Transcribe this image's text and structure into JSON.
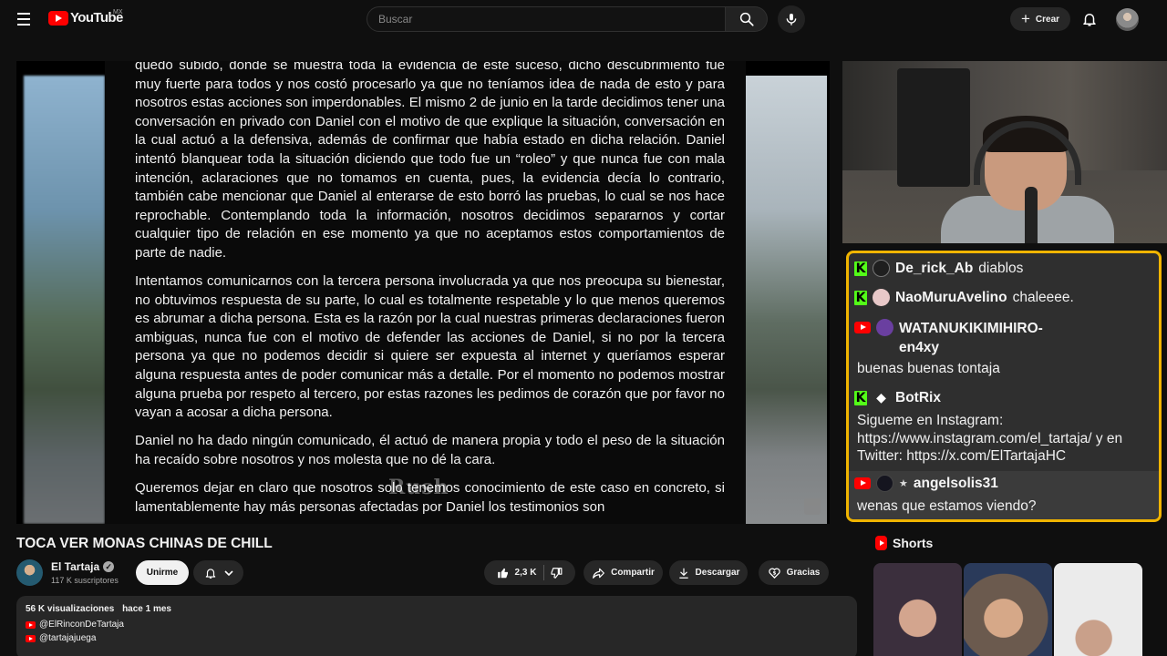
{
  "header": {
    "logo_text": "YouTube",
    "country": "MX",
    "search_placeholder": "Buscar",
    "create_label": "Crear"
  },
  "video": {
    "document_paragraphs": [
      "quedó subido, donde se muestra toda la evidencia de este suceso, dicho descubrimiento fue muy fuerte para todos y nos costó procesarlo ya que no teníamos idea de nada de esto y para nosotros estas acciones son imperdonables. El mismo 2 de junio en la tarde decidimos tener una conversación en privado con Daniel con el motivo de que explique la situación, conversación en la cual actuó a la defensiva, además de confirmar que había estado en dicha relación. Daniel intentó blanquear toda la situación diciendo que todo fue un “roleo” y que nunca fue con mala intención, aclaraciones que no tomamos en cuenta, pues, la evidencia decía lo contrario, también cabe mencionar que Daniel al enterarse de esto borró las pruebas, lo cual se nos hace reprochable. Contemplando toda la información, nosotros decidimos separarnos y cortar cualquier tipo de relación en ese momento ya que no aceptamos estos comportamientos de parte de nadie.",
      "Intentamos comunicarnos con la tercera persona involucrada ya que nos preocupa su bienestar, no obtuvimos respuesta de su parte, lo cual es totalmente respetable y lo que menos queremos es abrumar a dicha persona. Esta es la razón por la cual nuestras primeras declaraciones fueron ambiguas, nunca fue con el motivo de defender las acciones de Daniel, si no por la tercera persona ya que no podemos decidir si quiere ser expuesta al internet y queríamos esperar alguna respuesta antes de poder comunicar más a detalle. Por el momento no podemos mostrar alguna prueba por respeto al tercero, por estas razones les pedimos de corazón que por favor no vayan a acosar a dicha persona.",
      "Daniel no ha dado ningún comunicado, él actuó de manera propia y todo el peso de la situación ha recaído sobre nosotros y nos molesta que no dé la cara.",
      "Queremos dejar en claro que nosotros solo tenemos conocimiento de este caso en concreto, si lamentablemente hay más personas afectadas por Daniel los testimonios son"
    ],
    "watermark": "Rush"
  },
  "chat": {
    "messages": [
      {
        "platform": "kick",
        "user": "De_rick_Ab",
        "text": "diablos"
      },
      {
        "platform": "kick",
        "user": "NaoMuruAvelino",
        "text": "chaleeee."
      },
      {
        "platform": "youtube",
        "user": "WATANUKIKIMIHIRO-en4xy",
        "text": "buenas buenas tontaja"
      },
      {
        "platform": "kick",
        "user": "BotRix",
        "text": "Sigueme en Instagram: https://www.instagram.com/el_tartaja/ y en Twitter: https://x.com/ElTartajaHC"
      },
      {
        "platform": "youtube",
        "user": "angelsolis31",
        "badge": "★",
        "text": "wenas que estamos viendo?"
      }
    ]
  },
  "video_info": {
    "title": "TOCA VER MONAS CHINAS DE CHILL",
    "channel_name": "El Tartaja",
    "subscribers": "117 K suscriptores",
    "subscribe_label": "Unirme",
    "likes": "2,3 K",
    "share_label": "Compartir",
    "download_label": "Descargar",
    "thanks_label": "Gracias"
  },
  "description": {
    "views": "56 K visualizaciones",
    "date": "hace 1 mes",
    "links": [
      "@ElRinconDeTartaja",
      "@tartajajuega"
    ]
  },
  "sidebar": {
    "shorts_label": "Shorts"
  },
  "colors": {
    "background": "#0f0f0f",
    "youtube_red": "#ff0000",
    "kick_green": "#53fc18",
    "chat_border": "#f0b400"
  }
}
